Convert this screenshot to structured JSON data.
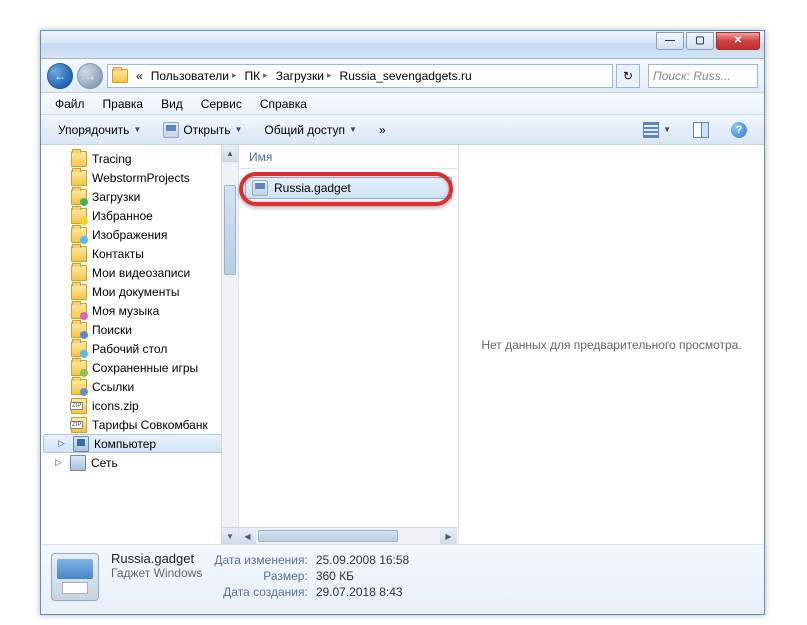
{
  "titlebar": {
    "min": "—",
    "max": "▢",
    "close": "✕"
  },
  "nav": {
    "back": "←",
    "fwd": "→",
    "crumb_prefix": "«",
    "crumbs": [
      "Пользователи",
      "ПК",
      "Загрузки",
      "Russia_sevengadgets.ru"
    ],
    "refresh": "↻",
    "search_placeholder": "Поиск: Russ..."
  },
  "menu": {
    "items": [
      "Файл",
      "Правка",
      "Вид",
      "Сервис",
      "Справка"
    ]
  },
  "toolbar": {
    "organize": "Упорядочить",
    "open": "Открыть",
    "share": "Общий доступ",
    "more": "»",
    "help": "?"
  },
  "sidebar": {
    "items": [
      {
        "label": "Tracing",
        "cls": "ico-folder"
      },
      {
        "label": "WebstormProjects",
        "cls": "ico-folder"
      },
      {
        "label": "Загрузки",
        "cls": "ico-folder accent green"
      },
      {
        "label": "Избранное",
        "cls": "ico-folder accent star"
      },
      {
        "label": "Изображения",
        "cls": "ico-folder accent img"
      },
      {
        "label": "Контакты",
        "cls": "ico-folder"
      },
      {
        "label": "Мои видеозаписи",
        "cls": "ico-folder"
      },
      {
        "label": "Мои документы",
        "cls": "ico-folder"
      },
      {
        "label": "Моя музыка",
        "cls": "ico-folder accent mus"
      },
      {
        "label": "Поиски",
        "cls": "ico-folder accent search"
      },
      {
        "label": "Рабочий стол",
        "cls": "ico-folder accent desk"
      },
      {
        "label": "Сохраненные игры",
        "cls": "ico-folder accent game"
      },
      {
        "label": "Ссылки",
        "cls": "ico-folder accent link"
      },
      {
        "label": "icons.zip",
        "cls": "ico-zip"
      },
      {
        "label": "Тарифы Совкомбанк",
        "cls": "ico-zip"
      }
    ],
    "computer": "Компьютер",
    "network": "Сеть"
  },
  "filelist": {
    "col_name": "Имя",
    "item": "Russia.gadget"
  },
  "preview": {
    "empty": "Нет данных для предварительного просмотра."
  },
  "details": {
    "name": "Russia.gadget",
    "type": "Гаджет Windows",
    "labels": {
      "modified": "Дата изменения:",
      "size": "Размер:",
      "created": "Дата создания:"
    },
    "values": {
      "modified": "25.09.2008 16:58",
      "size": "360 КБ",
      "created": "29.07.2018 8:43"
    }
  }
}
